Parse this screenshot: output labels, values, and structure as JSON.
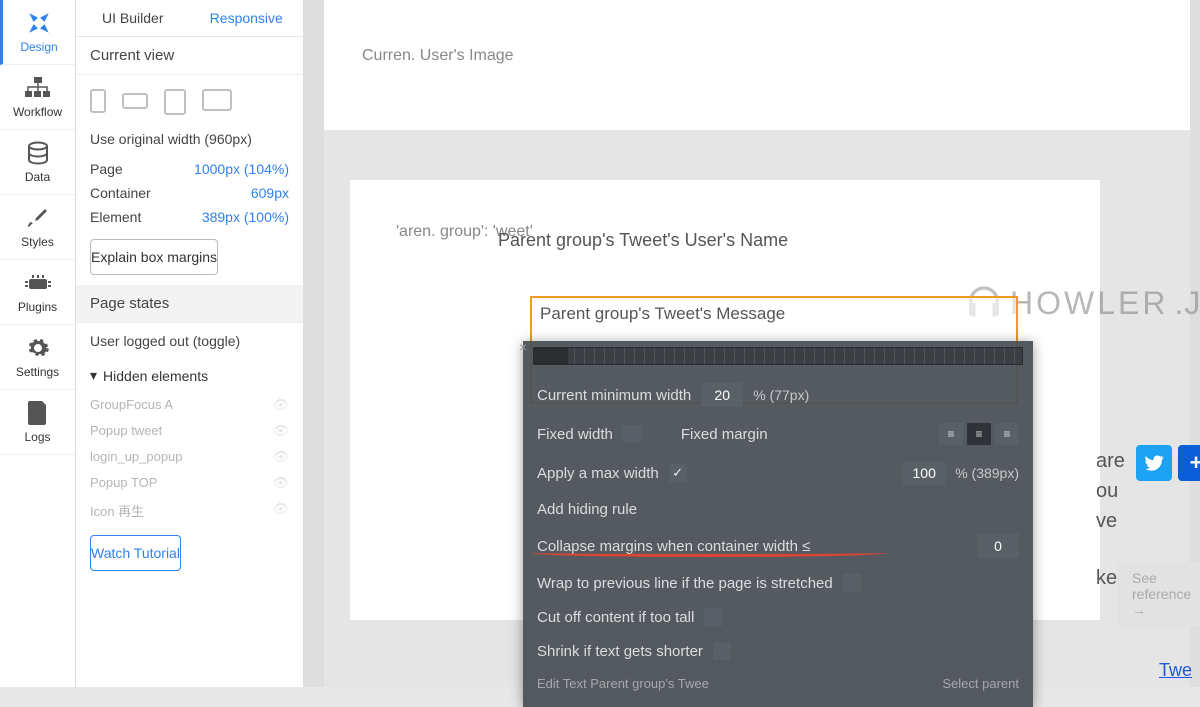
{
  "nav": {
    "items": [
      {
        "label": "Design",
        "icon": "design"
      },
      {
        "label": "Workflow",
        "icon": "workflow"
      },
      {
        "label": "Data",
        "icon": "data"
      },
      {
        "label": "Styles",
        "icon": "styles"
      },
      {
        "label": "Plugins",
        "icon": "plugins"
      },
      {
        "label": "Settings",
        "icon": "settings"
      },
      {
        "label": "Logs",
        "icon": "logs"
      }
    ]
  },
  "tabs": {
    "ui_builder": "UI Builder",
    "responsive": "Responsive"
  },
  "current_view": {
    "header": "Current view",
    "original_width": "Use original width (960px)",
    "rows": [
      {
        "label": "Page",
        "value": "1000px (104%)"
      },
      {
        "label": "Container",
        "value": "609px"
      },
      {
        "label": "Element",
        "value": "389px (100%)"
      }
    ],
    "explain_btn": "Explain box margins"
  },
  "page_states": {
    "header": "Page states",
    "logged_out": "User logged out (toggle)"
  },
  "hidden": {
    "header": "Hidden elements",
    "items": [
      "GroupFocus A",
      "Popup tweet",
      "login_up_popup",
      "Popup TOP",
      "Icon 再生"
    ]
  },
  "watch_tutorial": "Watch Tutorial",
  "canvas": {
    "user_image_placeholder": "Curren.\nUser's\nImage",
    "parent_image_placeholder": "'aren.\ngroup':\n'weet'",
    "tweet_user": "Parent group's Tweet's User's Name",
    "tweet_message": "Parent group's Tweet's Message",
    "howler": "HOWLER",
    "howler_js": ".JS",
    "side_lines": [
      "are",
      "ou",
      "ve",
      "ke"
    ],
    "see_reference": "See reference →",
    "tweet_link": "Twe"
  },
  "props": {
    "min_width_label": "Current minimum width",
    "min_width_value": "20",
    "min_width_unit": "% (77px)",
    "fixed_width": "Fixed width",
    "fixed_margin": "Fixed margin",
    "apply_max": "Apply a max width",
    "max_value": "100",
    "max_unit": "% (389px)",
    "add_hiding": "Add hiding rule",
    "collapse": "Collapse margins when container width ≤",
    "collapse_value": "0",
    "wrap": "Wrap to previous line if the page is stretched",
    "cutoff": "Cut off content if too tall",
    "shrink": "Shrink if text gets shorter",
    "edit_text": "Edit Text Parent group's Twee",
    "select_parent": "Select parent"
  },
  "colors": {
    "accent": "#3182ee",
    "orange": "#ee9a1f",
    "panel": "#4a5056"
  }
}
